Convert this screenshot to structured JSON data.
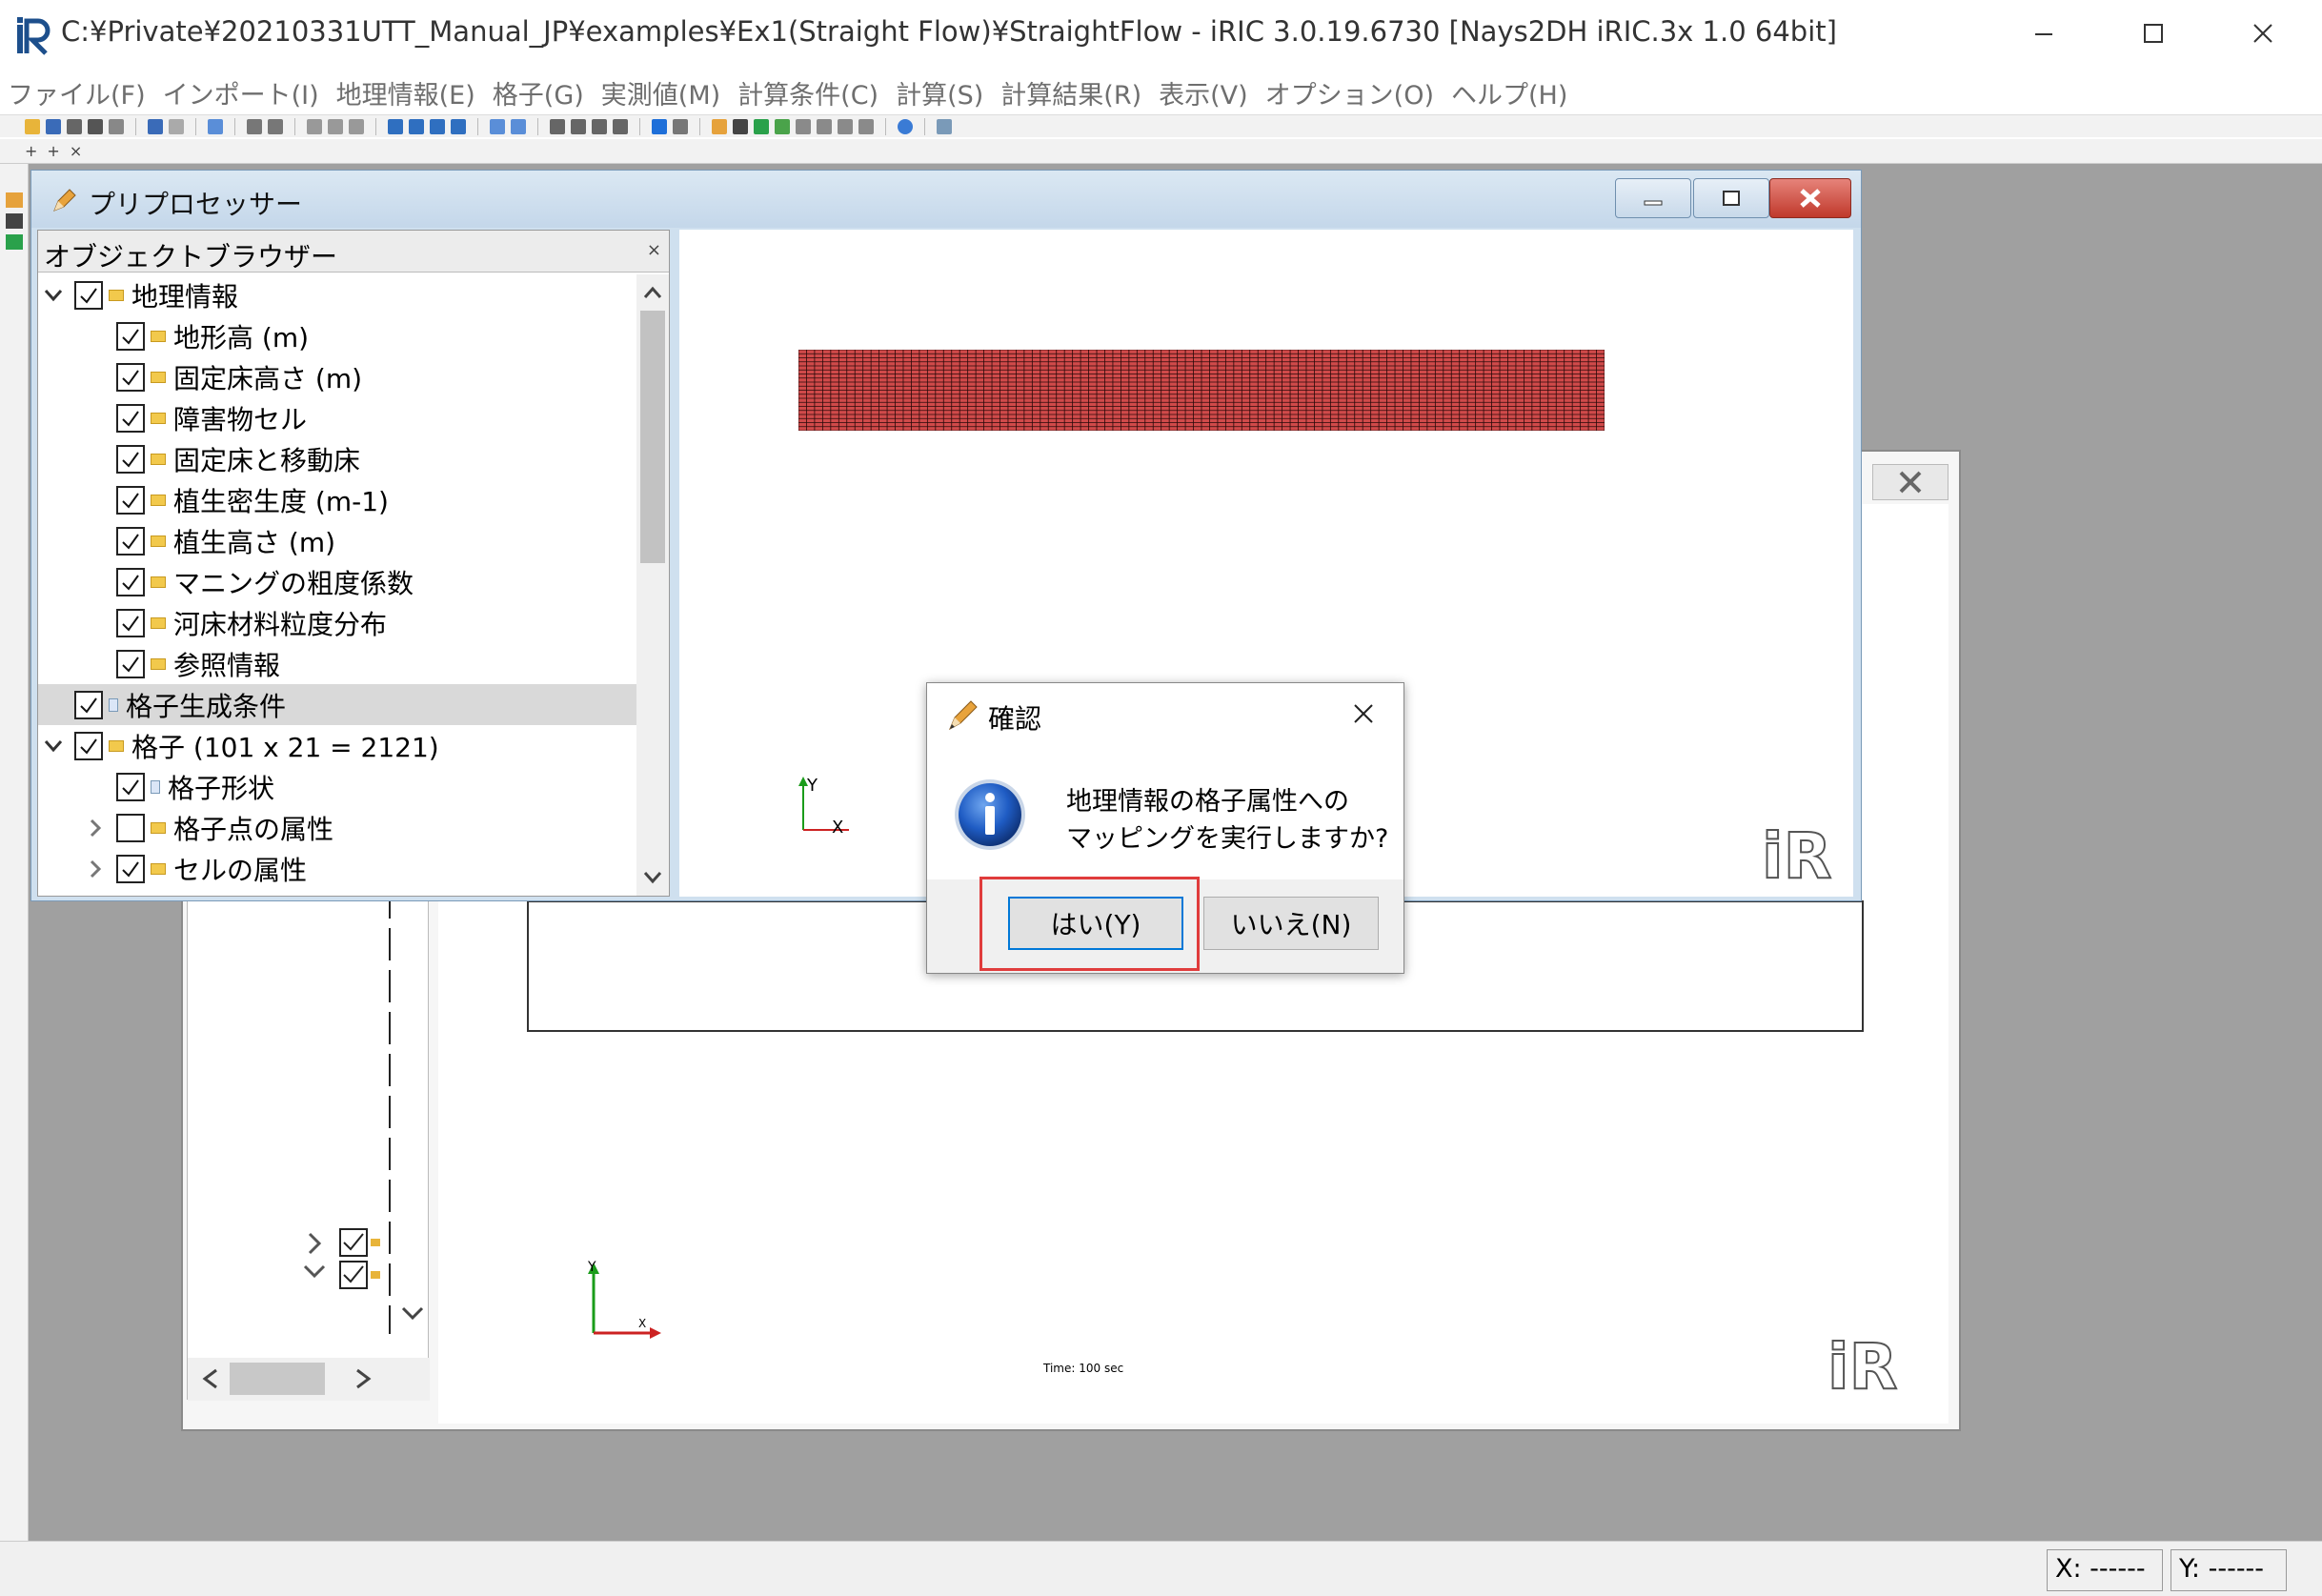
{
  "window": {
    "title": "C:¥Private¥20210331UTT_Manual_JP¥examples¥Ex1(Straight Flow)¥StraightFlow - iRIC 3.0.19.6730 [Nays2DH iRIC.3x 1.0 64bit]"
  },
  "menu": [
    "ファイル(F)",
    "インポート(I)",
    "地理情報(E)",
    "格子(G)",
    "実測値(M)",
    "計算条件(C)",
    "計算(S)",
    "計算結果(R)",
    "表示(V)",
    "オプション(O)",
    "ヘルプ(H)"
  ],
  "subtoolbar": {
    "items": [
      "+",
      "+",
      "×"
    ]
  },
  "pre_window": {
    "title": "プリプロセッサー"
  },
  "object_browser": {
    "title": "オブジェクトブラウザー",
    "close": "×",
    "items": [
      {
        "label": "地理情報",
        "checked": true,
        "expand": "open"
      },
      {
        "label": "地形高 (m)",
        "checked": true
      },
      {
        "label": "固定床高さ (m)",
        "checked": true
      },
      {
        "label": "障害物セル",
        "checked": true
      },
      {
        "label": "固定床と移動床",
        "checked": true
      },
      {
        "label": "植生密生度 (m-1)",
        "checked": true
      },
      {
        "label": "植生高さ (m)",
        "checked": true
      },
      {
        "label": "マニングの粗度係数",
        "checked": true
      },
      {
        "label": "河床材料粒度分布",
        "checked": true
      },
      {
        "label": "参照情報",
        "checked": true
      },
      {
        "label": "格子生成条件",
        "checked": true,
        "selected": true
      },
      {
        "label": "格子 (101 x 21 = 2121)",
        "checked": true,
        "expand": "open"
      },
      {
        "label": "格子形状",
        "checked": true
      },
      {
        "label": "格子点の属性",
        "checked": false,
        "expand": "closed"
      },
      {
        "label": "セルの属性",
        "checked": true,
        "expand": "closed"
      }
    ]
  },
  "pre_canvas": {
    "axis_y": "Y",
    "axis_x": "X",
    "mesh_color": "#d04a4a"
  },
  "bg_window": {
    "axis_y": "Y",
    "axis_x": "X",
    "time": "Time:  100 sec"
  },
  "dialog": {
    "title": "確認",
    "close": "×",
    "message_line1": "地理情報の格子属性への",
    "message_line2": "マッピングを実行しますか?",
    "yes": "はい(Y)",
    "no": "いいえ(N)",
    "highlight_color": "#e03c3c"
  },
  "status": {
    "x": "X: ------",
    "y": "Y: ------"
  },
  "colors": {
    "mdi_background": "#a0a0a0",
    "accent": "#0078d7"
  }
}
